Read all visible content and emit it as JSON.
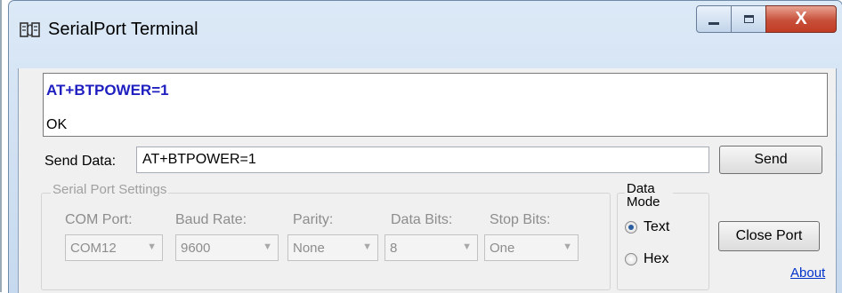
{
  "window": {
    "title": "SerialPort Terminal",
    "controls": {
      "close_glyph": "X"
    }
  },
  "output": {
    "lines": [
      "AT+BTPOWER=1",
      "OK"
    ]
  },
  "send": {
    "label": "Send Data:",
    "value": "AT+BTPOWER=1",
    "button": "Send"
  },
  "serial_settings": {
    "legend": "Serial Port Settings",
    "fields": [
      {
        "label": "COM Port:",
        "value": "COM12"
      },
      {
        "label": "Baud Rate:",
        "value": "9600"
      },
      {
        "label": "Parity:",
        "value": "None"
      },
      {
        "label": "Data Bits:",
        "value": "8"
      },
      {
        "label": "Stop Bits:",
        "value": "One"
      }
    ]
  },
  "data_mode": {
    "legend": "Data Mode",
    "options": [
      {
        "label": "Text",
        "selected": true
      },
      {
        "label": "Hex",
        "selected": false
      }
    ]
  },
  "actions": {
    "close_port": "Close Port",
    "about": "About"
  },
  "colors": {
    "command_text": "#1f1fc0",
    "link": "#0033cc",
    "close_button": "#c7503a"
  }
}
